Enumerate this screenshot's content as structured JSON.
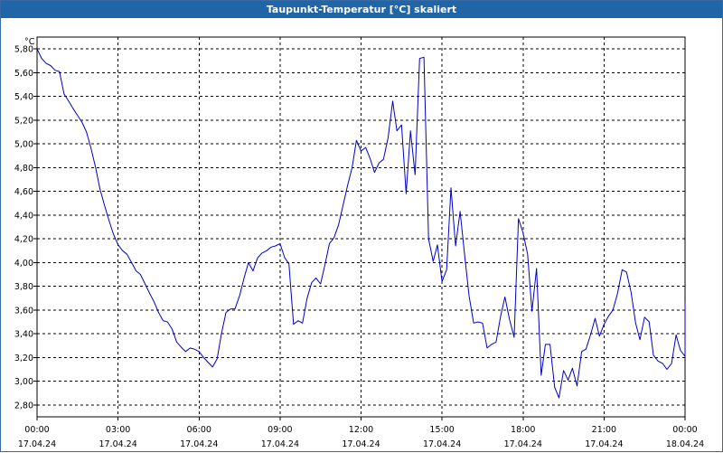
{
  "window": {
    "title": "Taupunkt-Temperatur [°C] skaliert"
  },
  "chart_data": {
    "type": "line",
    "title": "Taupunkt-Temperatur [°C] skaliert",
    "ylabel": "°C",
    "xlabel": "",
    "ylim": [
      2.7,
      5.9
    ],
    "xlim": [
      0,
      24
    ],
    "grid": true,
    "y_ticks": [
      "2,80",
      "3,00",
      "3,20",
      "3,40",
      "3,60",
      "3,80",
      "4,00",
      "4,20",
      "4,40",
      "4,60",
      "4,80",
      "5,00",
      "5,20",
      "5,40",
      "5,60",
      "5,80"
    ],
    "x_ticks": [
      {
        "time": "00:00",
        "date": "17.04.24"
      },
      {
        "time": "03:00",
        "date": "17.04.24"
      },
      {
        "time": "06:00",
        "date": "17.04.24"
      },
      {
        "time": "09:00",
        "date": "17.04.24"
      },
      {
        "time": "12:00",
        "date": "17.04.24"
      },
      {
        "time": "15:00",
        "date": "17.04.24"
      },
      {
        "time": "18:00",
        "date": "17.04.24"
      },
      {
        "time": "21:00",
        "date": "17.04.24"
      },
      {
        "time": "00:00",
        "date": "18.04.24"
      }
    ],
    "series": [
      {
        "color": "#0000c8",
        "points": [
          [
            0.0,
            5.8
          ],
          [
            0.17,
            5.72
          ],
          [
            0.33,
            5.68
          ],
          [
            0.5,
            5.66
          ],
          [
            0.67,
            5.62
          ],
          [
            0.83,
            5.61
          ],
          [
            1.0,
            5.42
          ],
          [
            1.17,
            5.36
          ],
          [
            1.33,
            5.3
          ],
          [
            1.5,
            5.24
          ],
          [
            1.67,
            5.18
          ],
          [
            1.83,
            5.1
          ],
          [
            2.0,
            4.96
          ],
          [
            2.17,
            4.8
          ],
          [
            2.33,
            4.62
          ],
          [
            2.5,
            4.48
          ],
          [
            2.67,
            4.35
          ],
          [
            2.83,
            4.24
          ],
          [
            3.0,
            4.15
          ],
          [
            3.17,
            4.1
          ],
          [
            3.33,
            4.07
          ],
          [
            3.5,
            4.0
          ],
          [
            3.67,
            3.93
          ],
          [
            3.83,
            3.9
          ],
          [
            4.0,
            3.82
          ],
          [
            4.17,
            3.74
          ],
          [
            4.33,
            3.67
          ],
          [
            4.5,
            3.58
          ],
          [
            4.67,
            3.51
          ],
          [
            4.83,
            3.5
          ],
          [
            5.0,
            3.44
          ],
          [
            5.17,
            3.33
          ],
          [
            5.33,
            3.29
          ],
          [
            5.5,
            3.25
          ],
          [
            5.67,
            3.28
          ],
          [
            5.83,
            3.27
          ],
          [
            6.0,
            3.25
          ],
          [
            6.17,
            3.2
          ],
          [
            6.33,
            3.16
          ],
          [
            6.5,
            3.12
          ],
          [
            6.67,
            3.19
          ],
          [
            6.83,
            3.4
          ],
          [
            7.0,
            3.58
          ],
          [
            7.17,
            3.61
          ],
          [
            7.33,
            3.61
          ],
          [
            7.5,
            3.72
          ],
          [
            7.67,
            3.87
          ],
          [
            7.83,
            4.0
          ],
          [
            8.0,
            3.93
          ],
          [
            8.17,
            4.04
          ],
          [
            8.33,
            4.08
          ],
          [
            8.5,
            4.1
          ],
          [
            8.67,
            4.13
          ],
          [
            8.83,
            4.14
          ],
          [
            9.0,
            4.16
          ],
          [
            9.17,
            4.04
          ],
          [
            9.33,
            3.99
          ],
          [
            9.5,
            3.48
          ],
          [
            9.67,
            3.51
          ],
          [
            9.83,
            3.49
          ],
          [
            10.0,
            3.7
          ],
          [
            10.17,
            3.83
          ],
          [
            10.33,
            3.87
          ],
          [
            10.5,
            3.82
          ],
          [
            10.67,
            3.99
          ],
          [
            10.83,
            4.16
          ],
          [
            11.0,
            4.21
          ],
          [
            11.17,
            4.32
          ],
          [
            11.33,
            4.48
          ],
          [
            11.5,
            4.65
          ],
          [
            11.67,
            4.8
          ],
          [
            11.83,
            5.03
          ],
          [
            12.0,
            4.94
          ],
          [
            12.17,
            4.97
          ],
          [
            12.33,
            4.88
          ],
          [
            12.5,
            4.76
          ],
          [
            12.67,
            4.84
          ],
          [
            12.83,
            4.87
          ],
          [
            13.0,
            5.05
          ],
          [
            13.17,
            5.36
          ],
          [
            13.33,
            5.11
          ],
          [
            13.5,
            5.16
          ],
          [
            13.67,
            4.58
          ],
          [
            13.83,
            5.11
          ],
          [
            14.0,
            4.74
          ],
          [
            14.17,
            5.72
          ],
          [
            14.33,
            5.73
          ],
          [
            14.5,
            4.2
          ],
          [
            14.67,
            4.01
          ],
          [
            14.83,
            4.15
          ],
          [
            15.0,
            3.84
          ],
          [
            15.17,
            3.94
          ],
          [
            15.33,
            4.63
          ],
          [
            15.5,
            4.14
          ],
          [
            15.67,
            4.43
          ],
          [
            15.83,
            4.08
          ],
          [
            16.0,
            3.72
          ],
          [
            16.17,
            3.49
          ],
          [
            16.33,
            3.5
          ],
          [
            16.5,
            3.49
          ],
          [
            16.67,
            3.28
          ],
          [
            16.83,
            3.31
          ],
          [
            17.0,
            3.33
          ],
          [
            17.17,
            3.55
          ],
          [
            17.33,
            3.71
          ],
          [
            17.5,
            3.52
          ],
          [
            17.67,
            3.37
          ],
          [
            17.83,
            4.37
          ],
          [
            18.0,
            4.25
          ],
          [
            18.17,
            4.07
          ],
          [
            18.33,
            3.59
          ],
          [
            18.5,
            3.95
          ],
          [
            18.67,
            3.05
          ],
          [
            18.83,
            3.31
          ],
          [
            19.0,
            3.31
          ],
          [
            19.17,
            2.95
          ],
          [
            19.33,
            2.86
          ],
          [
            19.5,
            3.09
          ],
          [
            19.67,
            3.01
          ],
          [
            19.83,
            3.11
          ],
          [
            20.0,
            2.96
          ],
          [
            20.17,
            3.25
          ],
          [
            20.33,
            3.27
          ],
          [
            20.5,
            3.39
          ],
          [
            20.67,
            3.53
          ],
          [
            20.83,
            3.38
          ],
          [
            21.0,
            3.48
          ],
          [
            21.17,
            3.55
          ],
          [
            21.33,
            3.6
          ],
          [
            21.5,
            3.74
          ],
          [
            21.67,
            3.94
          ],
          [
            21.83,
            3.92
          ],
          [
            22.0,
            3.75
          ],
          [
            22.17,
            3.49
          ],
          [
            22.33,
            3.35
          ],
          [
            22.5,
            3.54
          ],
          [
            22.67,
            3.5
          ],
          [
            22.83,
            3.22
          ],
          [
            23.0,
            3.17
          ],
          [
            23.17,
            3.15
          ],
          [
            23.33,
            3.1
          ],
          [
            23.5,
            3.15
          ],
          [
            23.67,
            3.39
          ],
          [
            23.83,
            3.26
          ],
          [
            24.0,
            3.21
          ],
          [
            24.17,
            3.43
          ],
          [
            24.33,
            3.64
          ],
          [
            24.5,
            3.66
          ],
          [
            24.67,
            3.52
          ],
          [
            24.83,
            3.53
          ]
        ]
      }
    ]
  }
}
